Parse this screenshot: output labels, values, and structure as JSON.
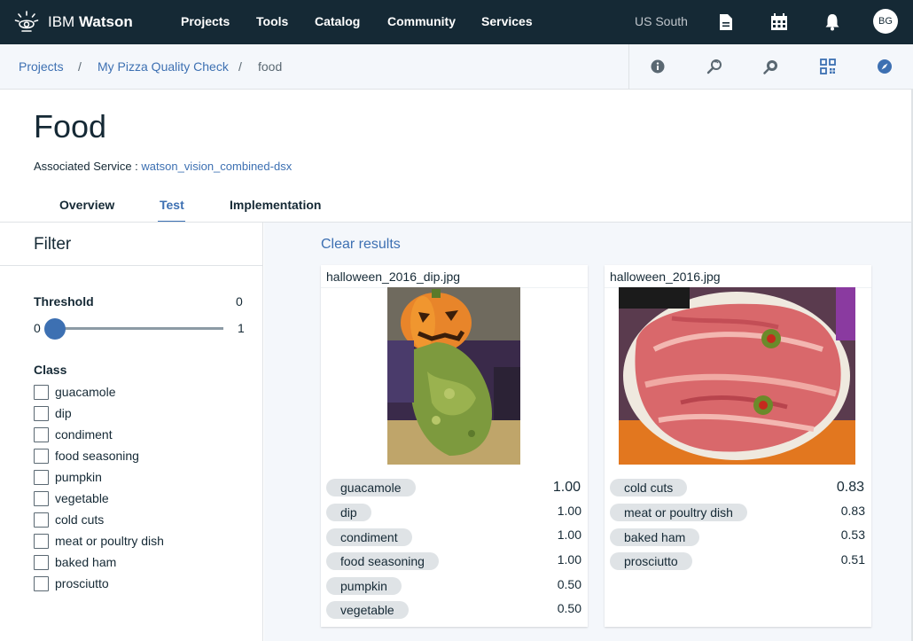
{
  "topnav": {
    "brand_light": "IBM ",
    "brand_bold": "Watson",
    "items": [
      "Projects",
      "Tools",
      "Catalog",
      "Community",
      "Services"
    ],
    "region": "US South",
    "avatar_initials": "BG",
    "icons": [
      "document-icon",
      "calendar-grid-icon",
      "bell-icon"
    ]
  },
  "breadcrumb": {
    "items": [
      "Projects",
      "My Pizza Quality Check"
    ],
    "separator": "/",
    "current": "food",
    "tool_icons": [
      "info-icon",
      "search-history-icon",
      "find-replace-icon",
      "qr-scan-icon",
      "compass-icon"
    ]
  },
  "page": {
    "title": "Food",
    "assoc_label": "Associated Service : ",
    "assoc_link": "watson_vision_combined-dsx",
    "tabs": [
      "Overview",
      "Test",
      "Implementation"
    ],
    "active_tab": "Test"
  },
  "filter": {
    "title": "Filter",
    "threshold_label": "Threshold",
    "threshold_value": "0",
    "slider_min": "0",
    "slider_max": "1",
    "slider_level": 0,
    "class_label": "Class",
    "classes": [
      "guacamole",
      "dip",
      "condiment",
      "food seasoning",
      "pumpkin",
      "vegetable",
      "cold cuts",
      "meat or poultry dish",
      "baked ham",
      "prosciutto"
    ]
  },
  "results": {
    "clear_label": "Clear results",
    "cards": [
      {
        "filename": "halloween_2016_dip.jpg",
        "tags": [
          {
            "label": "guacamole",
            "score": "1.00"
          },
          {
            "label": "dip",
            "score": "1.00"
          },
          {
            "label": "condiment",
            "score": "1.00"
          },
          {
            "label": "food seasoning",
            "score": "1.00"
          },
          {
            "label": "pumpkin",
            "score": "0.50"
          },
          {
            "label": "vegetable",
            "score": "0.50"
          }
        ]
      },
      {
        "filename": "halloween_2016.jpg",
        "tags": [
          {
            "label": "cold cuts",
            "score": "0.83"
          },
          {
            "label": "meat or poultry dish",
            "score": "0.83"
          },
          {
            "label": "baked ham",
            "score": "0.53"
          },
          {
            "label": "prosciutto",
            "score": "0.51"
          }
        ]
      }
    ]
  },
  "colors": {
    "nav_bg": "#152935",
    "accent": "#3d70b2",
    "panel_bg": "#f4f7fb",
    "tag_bg": "#dfe3e6"
  }
}
